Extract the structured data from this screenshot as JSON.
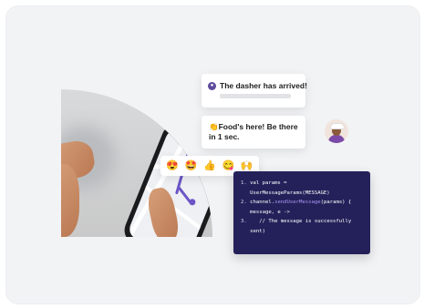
{
  "notification": {
    "title": "The dasher has arrived!"
  },
  "message": {
    "text": "Food's here! Be there in 1 sec.",
    "emoji": "👏"
  },
  "reactions": [
    "😍",
    "🤩",
    "👍",
    "😋",
    "🙌"
  ],
  "code": {
    "lines": [
      {
        "num": "1.",
        "text": "val params ="
      },
      {
        "num": "",
        "text": "UserMessageParams(MESSAGE)"
      },
      {
        "num": "2.",
        "pre": "channel.",
        "fn": "sendUserMessage",
        "post": "(params) {"
      },
      {
        "num": "",
        "text": "message, e ->"
      },
      {
        "num": "3.",
        "text": "// The message is successfully"
      },
      {
        "num": "",
        "text": "sent)"
      }
    ]
  },
  "colors": {
    "panel_bg": "#f2f3f5",
    "code_bg": "#24215a",
    "accent_purple": "#5d4a9c",
    "code_function": "#a996f5"
  }
}
